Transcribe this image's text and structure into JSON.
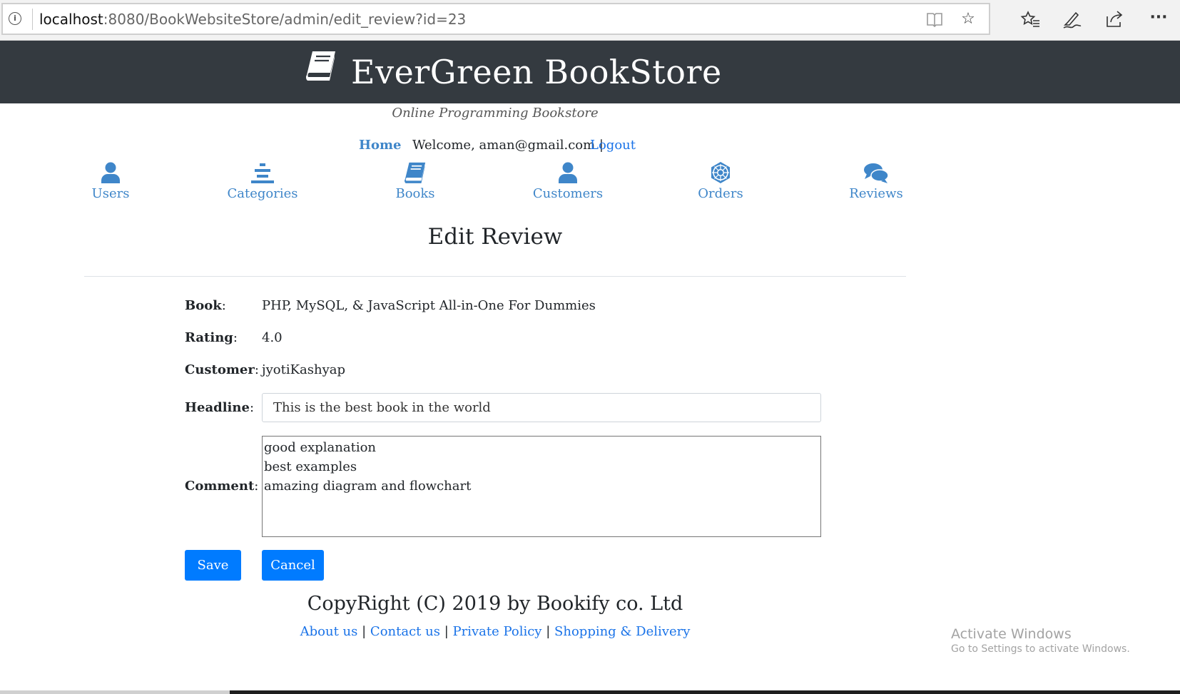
{
  "browser": {
    "url_host": "localhost",
    "url_path": ":8080/BookWebsiteStore/admin/edit_review?id=23"
  },
  "header": {
    "title": "EverGreen BookStore",
    "tagline": "Online Programming Bookstore",
    "home_link": "Home",
    "welcome": "Welcome, aman@gmail.com |",
    "logout_link": "Logout"
  },
  "nav": {
    "users": "Users",
    "categories": "Categories",
    "books": "Books",
    "customers": "Customers",
    "orders": "Orders",
    "reviews": "Reviews",
    "accent_color": "#3f86c9"
  },
  "page": {
    "title": "Edit Review"
  },
  "form": {
    "book_label": "Book",
    "book_value": "PHP, MySQL, & JavaScript All-in-One For Dummies",
    "rating_label": "Rating",
    "rating_value": "4.0",
    "customer_label": "Customer",
    "customer_value": "jyotiKashyap",
    "headline_label": "Headline",
    "headline_value": "This is the best book in the world",
    "comment_label": "Comment",
    "comment_lines": [
      " good explanation",
      "best examples",
      "amazing diagram and flowchart"
    ],
    "colon": ":",
    "save_label": "Save",
    "cancel_label": "Cancel",
    "button_color": "#007bff"
  },
  "footer": {
    "copyright": "CopyRight (C) 2019 by Bookify co. Ltd",
    "links": [
      "About us",
      "Contact us",
      "Private Policy",
      "Shopping & Delivery"
    ],
    "separator": "|"
  },
  "watermark": {
    "line1": "Activate Windows",
    "line2": "Go to Settings to activate Windows."
  }
}
